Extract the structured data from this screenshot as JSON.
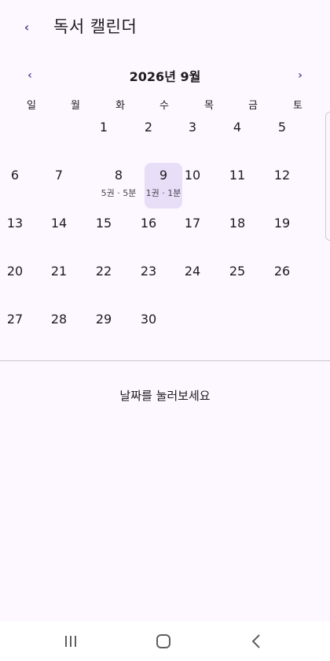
{
  "header": {
    "back_icon": "‹",
    "title": "독서 캘린더"
  },
  "calendar": {
    "prev_icon": "‹",
    "next_icon": "›",
    "month_title": "2026년 9월",
    "weekdays": [
      "일",
      "월",
      "화",
      "수",
      "목",
      "금",
      "토"
    ],
    "weeks": [
      [
        {
          "day": "",
          "sub": ""
        },
        {
          "day": "",
          "sub": ""
        },
        {
          "day": "1",
          "sub": ""
        },
        {
          "day": "2",
          "sub": ""
        },
        {
          "day": "3",
          "sub": ""
        },
        {
          "day": "4",
          "sub": ""
        },
        {
          "day": "5",
          "sub": ""
        }
      ],
      [
        {
          "day": "6",
          "sub": ""
        },
        {
          "day": "7",
          "sub": ""
        },
        {
          "day": "8",
          "sub": "5권 · 5분"
        },
        {
          "day": "9",
          "sub": "1권 · 1분",
          "selected": true
        },
        {
          "day": "10",
          "sub": ""
        },
        {
          "day": "11",
          "sub": ""
        },
        {
          "day": "12",
          "sub": ""
        }
      ],
      [
        {
          "day": "13",
          "sub": ""
        },
        {
          "day": "14",
          "sub": ""
        },
        {
          "day": "15",
          "sub": ""
        },
        {
          "day": "16",
          "sub": ""
        },
        {
          "day": "17",
          "sub": ""
        },
        {
          "day": "18",
          "sub": ""
        },
        {
          "day": "19",
          "sub": ""
        }
      ],
      [
        {
          "day": "20",
          "sub": ""
        },
        {
          "day": "21",
          "sub": ""
        },
        {
          "day": "22",
          "sub": ""
        },
        {
          "day": "23",
          "sub": ""
        },
        {
          "day": "24",
          "sub": ""
        },
        {
          "day": "25",
          "sub": ""
        },
        {
          "day": "26",
          "sub": ""
        }
      ],
      [
        {
          "day": "27",
          "sub": ""
        },
        {
          "day": "28",
          "sub": ""
        },
        {
          "day": "29",
          "sub": ""
        },
        {
          "day": "30",
          "sub": ""
        },
        {
          "day": "",
          "sub": ""
        },
        {
          "day": "",
          "sub": ""
        },
        {
          "day": "",
          "sub": ""
        }
      ]
    ],
    "selected_color": "#e8def8",
    "accent_color": "#5b4b9a"
  },
  "detail": {
    "hint": "날짜를 눌러보세요"
  },
  "navbar": {
    "recent_icon": "recent-apps-icon",
    "home_icon": "home-icon",
    "back_icon": "back-icon"
  }
}
